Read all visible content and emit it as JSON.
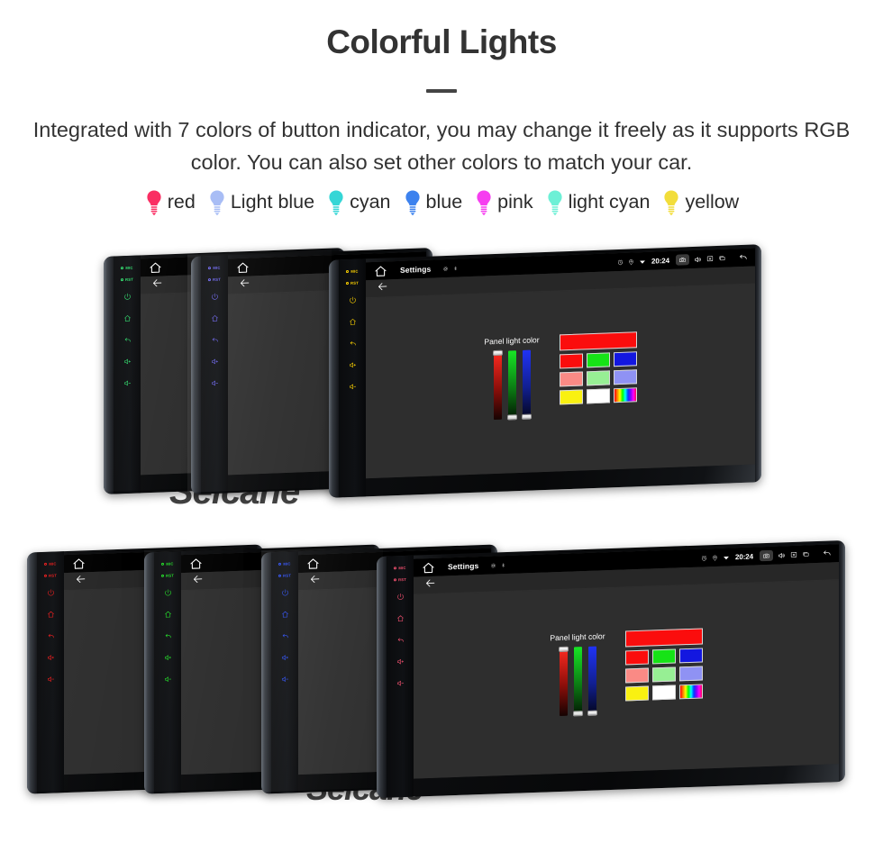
{
  "header": {
    "title": "Colorful Lights",
    "subtitle": "Integrated with 7 colors of button indicator, you may change it freely as it supports RGB color. You can also set other colors to match your car."
  },
  "legend": {
    "items": [
      {
        "label": "red",
        "color": "#fa2e63",
        "icon": "bulb-icon"
      },
      {
        "label": "Light blue",
        "color": "#a8bdf5",
        "icon": "bulb-icon"
      },
      {
        "label": "cyan",
        "color": "#35d6d6",
        "icon": "bulb-icon"
      },
      {
        "label": "blue",
        "color": "#3d82ee",
        "icon": "bulb-icon"
      },
      {
        "label": "pink",
        "color": "#f63ef0",
        "icon": "bulb-icon"
      },
      {
        "label": "light cyan",
        "color": "#6df0d6",
        "icon": "bulb-icon"
      },
      {
        "label": "yellow",
        "color": "#f2dd3a",
        "icon": "bulb-icon"
      }
    ]
  },
  "device_screen": {
    "statusbar": {
      "home_icon": "home-icon",
      "title": "Settings",
      "mini_icons": [
        "brightness-icon",
        "bluetooth-icon"
      ],
      "alarm_icon": "alarm-icon",
      "location_icon": "location-pin-icon",
      "wifi_icon": "wifi-icon",
      "time": "20:24",
      "camera_icon": "camera-icon",
      "volume_icon": "volume-icon",
      "close_icon": "close-box-icon",
      "recents_icon": "recents-icon",
      "back_icon": "back-arrow-icon"
    },
    "subbar": {
      "back_icon": "back-arrow-icon"
    },
    "panel": {
      "label": "Panel light color",
      "sliders": [
        {
          "name": "red-slider",
          "channel": "R",
          "thumb_position": "top"
        },
        {
          "name": "green-slider",
          "channel": "G",
          "thumb_position": "bottom"
        },
        {
          "name": "blue-slider",
          "channel": "B",
          "thumb_position": "bottom"
        }
      ],
      "preview_color": "#fb0d0d",
      "swatch_rows": [
        [
          {
            "color": "#fb0d0d",
            "name": "swatch-red"
          },
          {
            "color": "#16e316",
            "name": "swatch-green"
          },
          {
            "color": "#1317e0",
            "name": "swatch-blue"
          }
        ],
        [
          {
            "color": "#fa8a85",
            "name": "swatch-light-red"
          },
          {
            "color": "#97ef94",
            "name": "swatch-light-green"
          },
          {
            "color": "#8f92f4",
            "name": "swatch-light-blue"
          }
        ],
        [
          {
            "color": "#f9f111",
            "name": "swatch-yellow"
          },
          {
            "color": "#ffffff",
            "name": "swatch-white"
          },
          {
            "color": "rainbow",
            "name": "swatch-rainbow"
          }
        ]
      ]
    },
    "keys": {
      "mic_label": "MIC",
      "rst_label": "RST",
      "buttons": [
        "power-icon",
        "home-icon",
        "back-icon",
        "volume-up-icon",
        "volume-down-icon"
      ]
    }
  },
  "device_rows": {
    "top": [
      {
        "key_color": "#2fe06d",
        "name": "device-top-1"
      },
      {
        "key_color": "#6b63f0",
        "name": "device-top-2"
      },
      {
        "key_color": "#ffd400",
        "name": "device-top-3",
        "active": true
      }
    ],
    "bottom": [
      {
        "key_color": "#ee1b1b",
        "name": "device-bottom-1"
      },
      {
        "key_color": "#1fe024",
        "name": "device-bottom-2"
      },
      {
        "key_color": "#2a4cf5",
        "name": "device-bottom-3"
      },
      {
        "key_color": "#f2506f",
        "name": "device-bottom-4",
        "active": true
      }
    ]
  },
  "watermarks": [
    {
      "text": "Seicane",
      "name": "watermark-top"
    },
    {
      "text": "Seicane",
      "name": "watermark-bottom"
    }
  ]
}
